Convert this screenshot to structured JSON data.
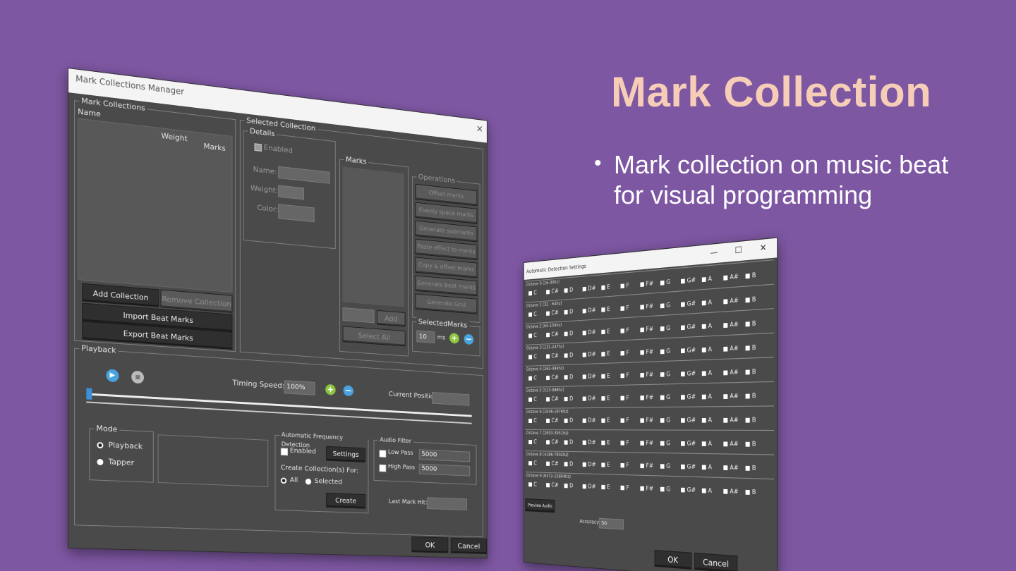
{
  "slide": {
    "title": "Mark Collection",
    "bullet": "Mark collection on music beat for visual programming"
  },
  "manager": {
    "title": "Mark Collections Manager",
    "close_glyph": "×",
    "mark_collections": {
      "legend": "Mark Collections",
      "col_name": "Name",
      "col_weight": "Weight",
      "col_marks": "Marks",
      "add_collection": "Add Collection",
      "remove_collection": "Remove Collection",
      "import_beat_marks": "Import Beat Marks",
      "export_beat_marks": "Export Beat Marks"
    },
    "selected_collection": {
      "legend": "Selected Collection",
      "details_legend": "Details",
      "enabled_label": "Enabled",
      "name_label": "Name:",
      "weight_label": "Weight:",
      "color_label": "Color:",
      "marks_legend": "Marks",
      "add_label": "Add",
      "select_all_label": "Select All",
      "operations_legend": "Operations",
      "operations": [
        "Offset marks",
        "Evenly space marks",
        "Generate submarks",
        "Paste effect to marks",
        "Copy & offset marks",
        "Generate beat marks",
        "Generate Grid"
      ],
      "selected_marks_legend": "SelectedMarks",
      "selected_marks_value": "10",
      "ms_label": "ms"
    },
    "playback": {
      "legend": "Playback",
      "timing_speed_label": "Timing Speed:",
      "timing_speed_value": "100%",
      "current_position_label": "Current Position:",
      "mode_legend": "Mode",
      "mode_playback": "Playback",
      "mode_tapper": "Tapper",
      "afd_legend": "Automatic Frequency Detection",
      "afd_enabled": "Enabled",
      "settings_btn": "Settings",
      "create_for_label": "Create Collection(s) For:",
      "opt_all": "All",
      "opt_selected": "Selected",
      "create_btn": "Create",
      "audio_filter_legend": "Audio Filter",
      "low_pass_label": "Low Pass",
      "low_pass_value": "5000",
      "high_pass_label": "High Pass",
      "high_pass_value": "5000",
      "last_mark_hit_label": "Last Mark Hit:"
    },
    "ok": "OK",
    "cancel": "Cancel"
  },
  "detection": {
    "title": "Automatic Detection Settings",
    "minimize": "—",
    "maximize": "☐",
    "close": "✕",
    "notes": [
      "C",
      "C#",
      "D",
      "D#",
      "E",
      "F",
      "F#",
      "G",
      "G#",
      "A",
      "A#",
      "B"
    ],
    "octaves": [
      "Octave 0 (16-30hz)",
      "Octave 1 (32 - 64hz)",
      "Octave 2 (65-104hz)",
      "Octave 3 (131-247hz)",
      "Octave 4 (262-494hz)",
      "Octave 5 (523-988hz)",
      "Octave 6 (1046-1976hz)",
      "Octave 7 (2093-3951hz)",
      "Octave 8 (4186-7902hz)",
      "Octave 9 (8372-15804hz)"
    ],
    "preview_audio": "Preview Audio",
    "accuracy_label": "Accuracy",
    "accuracy_value": "50",
    "ok": "OK",
    "cancel": "Cancel"
  }
}
